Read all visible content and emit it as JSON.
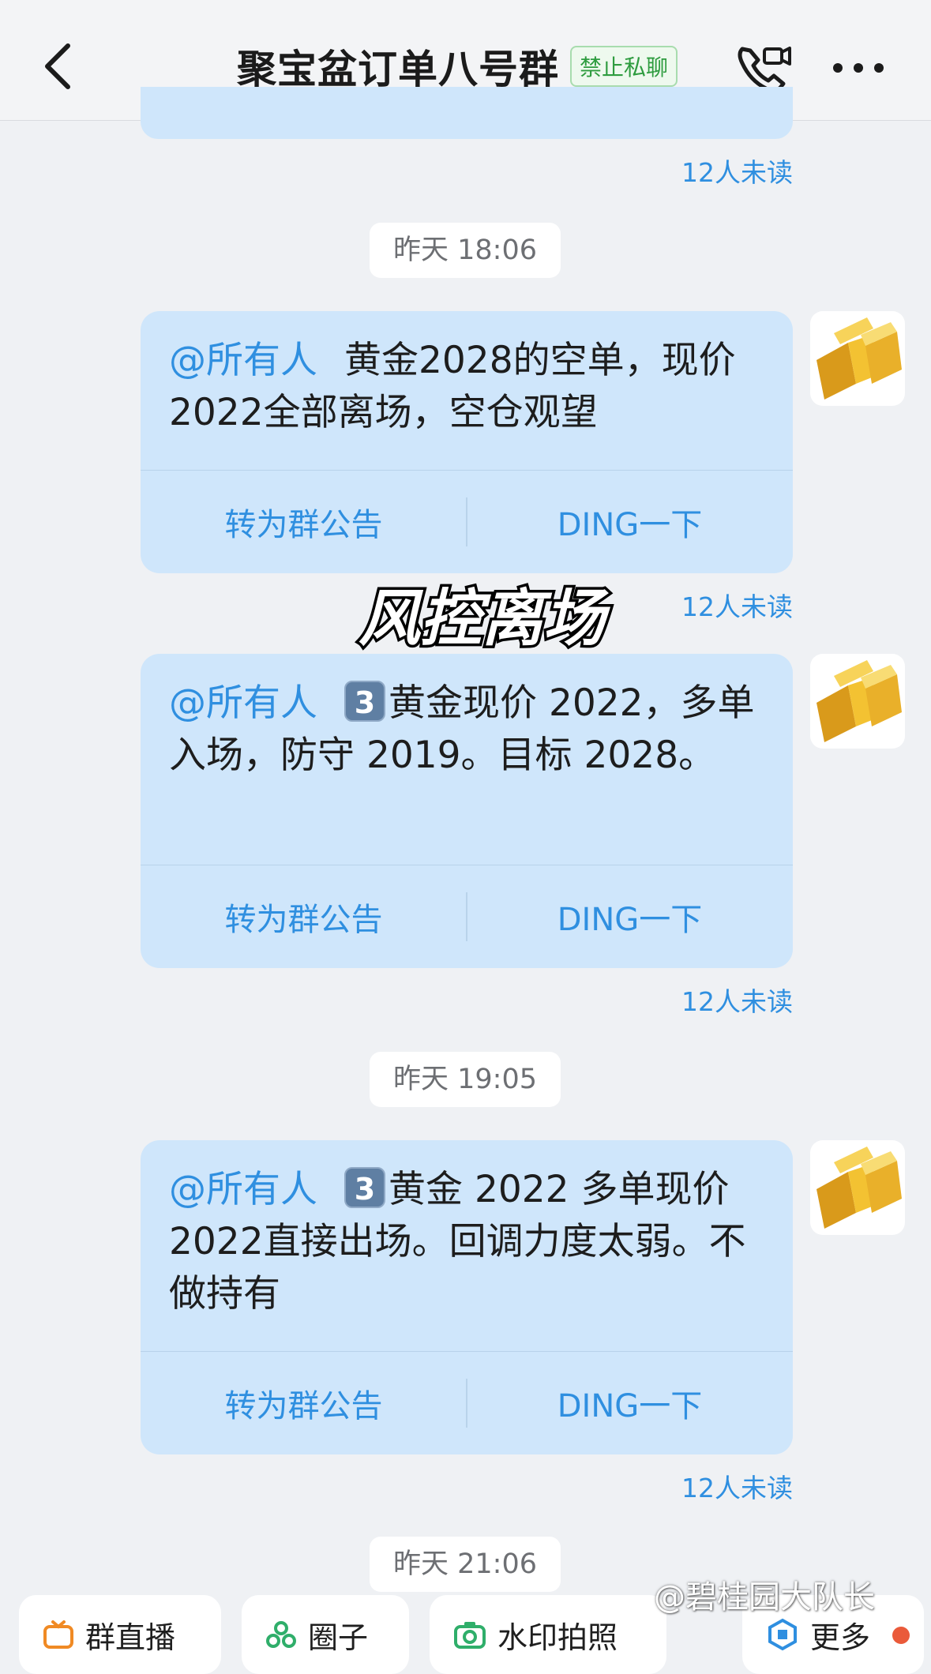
{
  "header": {
    "title": "聚宝盆订单八号群",
    "badge": "禁止私聊",
    "icons": [
      "back-icon",
      "video-call-icon",
      "more-icon"
    ]
  },
  "messages": [
    {
      "unread": "12人未读"
    },
    {
      "time": "昨天 18:06",
      "mention": "@所有人",
      "text": "黄金2028的空单，现价2022全部离场，空仓观望",
      "action_left": "转为群公告",
      "action_right": "DING一下",
      "unread": "12人未读"
    },
    {
      "mention": "@所有人",
      "number": "3",
      "text": "黄金现价 2022，多单入场，防守 2019。目标 2028。",
      "action_left": "转为群公告",
      "action_right": "DING一下",
      "unread": "12人未读"
    },
    {
      "time": "昨天 19:05",
      "mention": "@所有人",
      "number": "3",
      "text": "黄金 2022 多单现价 2022直接出场。回调力度太弱。不做持有",
      "action_left": "转为群公告",
      "action_right": "DING一下",
      "unread": "12人未读"
    },
    {
      "time": "昨天 21:06"
    }
  ],
  "overlay_caption": "风控离场",
  "toolbar": {
    "items": [
      "群直播",
      "圈子",
      "水印拍照",
      "更多"
    ],
    "icons": [
      "live-icon",
      "circle-icon",
      "camera-icon",
      "more-apps-icon"
    ]
  },
  "watermark": "@碧桂园大队长",
  "colors": {
    "accent": "#2f8fe0",
    "bubble": "#cfe6fb",
    "background": "#eff1f4",
    "badge_green": "#2e9c3f"
  }
}
